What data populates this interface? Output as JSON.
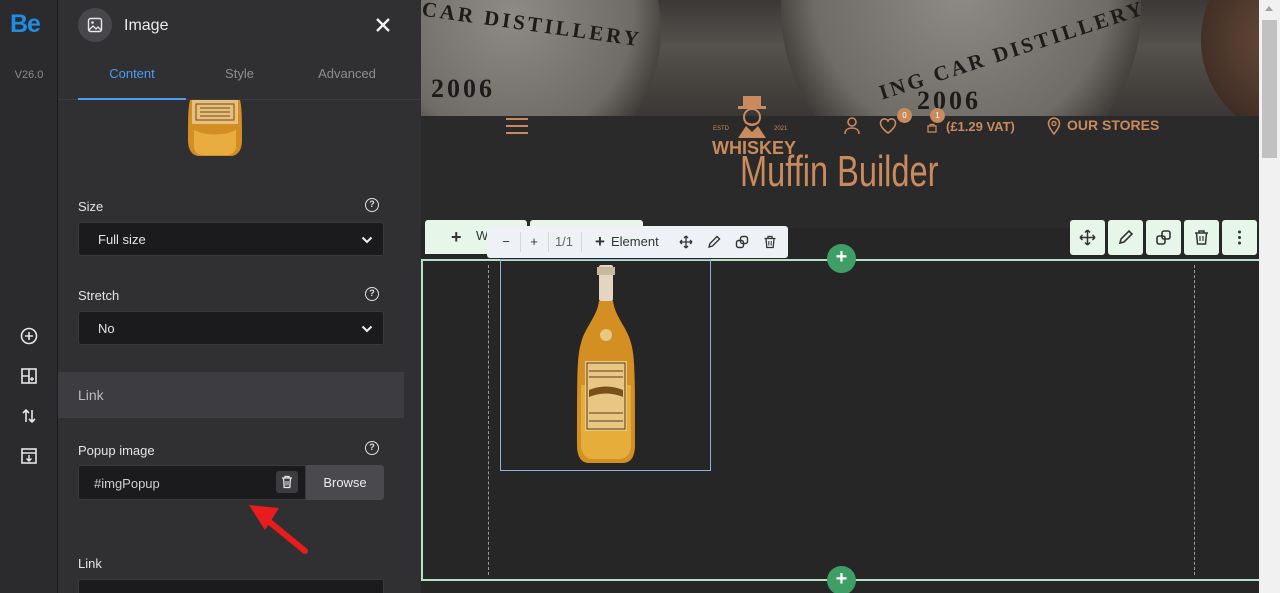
{
  "rail": {
    "logo": "Be",
    "version": "V26.0",
    "icons": [
      "add-circle-icon",
      "layout-add-icon",
      "sort-arrows-icon",
      "import-icon"
    ]
  },
  "panel": {
    "title": "Image",
    "tabs": [
      {
        "label": "Content",
        "active": true
      },
      {
        "label": "Style",
        "active": false
      },
      {
        "label": "Advanced",
        "active": false
      }
    ],
    "size_label": "Size",
    "size_value": "Full size",
    "stretch_label": "Stretch",
    "stretch_value": "No",
    "link_section": "Link",
    "popup_label": "Popup image",
    "popup_value": "#imgPopup",
    "browse_label": "Browse",
    "link_label": "Link"
  },
  "canvas": {
    "hero_stamps": [
      "CAR DISTILLERY",
      "2006",
      "ING CAR DISTILLERY",
      "2006"
    ],
    "brand_small_left": "ESTD",
    "brand_small_right": "2021",
    "brand_name": "WHISKEY",
    "site_title": "Muffin Builder",
    "wishlist_count": "0",
    "cart_count": "1",
    "cart_total": "(£1.29 VAT)",
    "stores_label": "OUR STORES",
    "wrap_tab_label": "W",
    "element_toolbar": {
      "minus": "−",
      "plus": "+",
      "size": "1/1",
      "element_label": "Element"
    },
    "add_label": "+"
  },
  "colors": {
    "accent": "#4a9ef0",
    "brand": "#c98a5d",
    "section_border": "#b5e3c4",
    "add_button": "#3f9e66",
    "arrow": "#e81c1c"
  }
}
